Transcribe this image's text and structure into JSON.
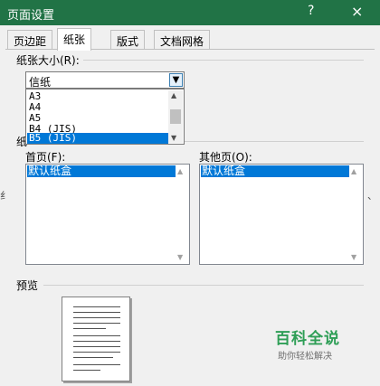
{
  "window": {
    "title": "页面设置",
    "help_label": "?",
    "close_label": "×"
  },
  "tabs": [
    {
      "label": "页边距"
    },
    {
      "label": "纸张"
    },
    {
      "label": "版式"
    },
    {
      "label": "文档网格"
    }
  ],
  "paper_size": {
    "label": "纸张大小(R):",
    "value": "信纸",
    "options": [
      {
        "label": "A3"
      },
      {
        "label": "A4"
      },
      {
        "label": "A5"
      },
      {
        "label": "B4 (JIS)"
      },
      {
        "label": "B5 (JIS)"
      }
    ]
  },
  "paper_source": {
    "label": "纸",
    "first_page": {
      "label": "首页(F):",
      "selected": "默认纸盒"
    },
    "other_pages": {
      "label": "其他页(O):",
      "selected": "默认纸盒"
    }
  },
  "preview": {
    "label": "预览"
  },
  "watermark": {
    "title": "百科全说",
    "subtitle": "助你轻松解决"
  }
}
